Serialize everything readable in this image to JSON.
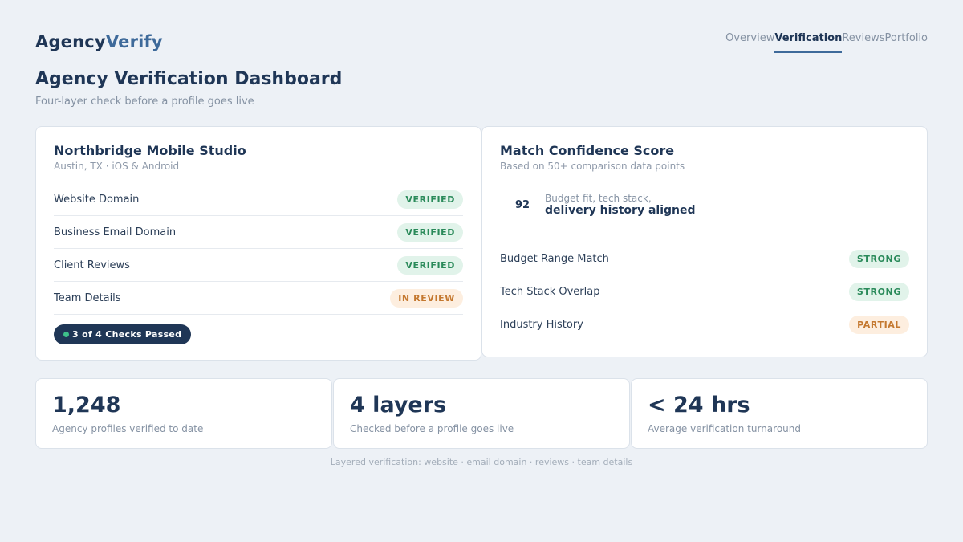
{
  "brand": {
    "part1": "Agency",
    "part2": "Verify"
  },
  "nav": {
    "tabs": [
      {
        "label": "Overview",
        "active": false
      },
      {
        "label": "Verification",
        "active": true
      },
      {
        "label": "Reviews",
        "active": false
      },
      {
        "label": "Portfolio",
        "active": false
      }
    ]
  },
  "header": {
    "title": "Agency Verification Dashboard",
    "subtitle": "Four-layer check before a profile goes live"
  },
  "agency_card": {
    "name": "Northbridge Mobile Studio",
    "meta": "Austin, TX · iOS & Android",
    "checks": [
      {
        "label": "Website Domain",
        "status": "VERIFIED",
        "tone": "green"
      },
      {
        "label": "Business Email Domain",
        "status": "VERIFIED",
        "tone": "green"
      },
      {
        "label": "Client Reviews",
        "status": "VERIFIED",
        "tone": "green"
      },
      {
        "label": "Team Details",
        "status": "IN REVIEW",
        "tone": "orange"
      }
    ],
    "summary": "3 of 4 Checks Passed"
  },
  "match_card": {
    "title": "Match Confidence Score",
    "subtitle": "Based on 50+ comparison data points",
    "score": "92",
    "score_line1": "Budget fit, tech stack,",
    "score_line2": "delivery history aligned",
    "factors": [
      {
        "label": "Budget Range Match",
        "status": "STRONG",
        "tone": "green"
      },
      {
        "label": "Tech Stack Overlap",
        "status": "STRONG",
        "tone": "green"
      },
      {
        "label": "Industry History",
        "status": "PARTIAL",
        "tone": "orange"
      }
    ]
  },
  "stats": [
    {
      "value": "1,248",
      "label": "Agency profiles verified to date"
    },
    {
      "value": "4 layers",
      "label": "Checked before a profile goes live"
    },
    {
      "value": "< 24 hrs",
      "label": "Average verification turnaround"
    }
  ],
  "footer": "Layered verification: website · email domain · reviews · team details",
  "colors": {
    "navy": "#1f3656",
    "accent": "#3e6a9a",
    "verified_green": "#2a8a5a",
    "review_orange": "#c4782f",
    "background": "#edf1f6"
  }
}
